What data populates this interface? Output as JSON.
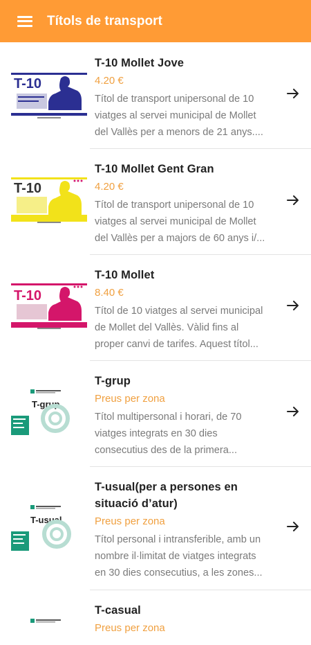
{
  "app": {
    "title": "Títols de transport"
  },
  "colors": {
    "accent": "#ff9b35",
    "price": "#f0a040"
  },
  "items": [
    {
      "title": "T-10 Mollet Jove",
      "price": "4.20 €",
      "desc1": "Títol de transport unipersonal de 10",
      "desc2": "viatges al servei municipal de Mollet",
      "desc3": "del Vallès per a menors de 21 anys....",
      "card_label": "T-10",
      "card_color": "#2b2f92"
    },
    {
      "title": "T-10 Mollet Gent Gran",
      "price": "4.20 €",
      "desc1": "Títol de transport unipersonal de 10",
      "desc2": "viatges al servei municipal de Mollet",
      "desc3": "del Vallès per a majors de 60 anys i/...",
      "card_label": "T-10",
      "card_color": "#f2e21a"
    },
    {
      "title": "T-10 Mollet",
      "price": "8.40 €",
      "desc1": "Títol de 10 viatges al servei municipal",
      "desc2": "de Mollet del Vallès. Vàlid fins al",
      "desc3": "proper canvi de tarifes. Aquest títol...",
      "card_label": "T-10",
      "card_color": "#d4166a"
    },
    {
      "title": "T-grup",
      "price": "Preus per zona",
      "desc1": "Títol multipersonal i horari, de 70",
      "desc2": "viatges integrats en 30 dies",
      "desc3": "consecutius des de la primera...",
      "card_label": "T-grup",
      "card_color": "#1a9a7a"
    },
    {
      "title": "T-usual(per a persones en",
      "title2": "situació d’atur)",
      "price": "Preus per zona",
      "desc1": "Títol personal i intransferible, amb un",
      "desc2": "nombre il·limitat de viatges integrats",
      "desc3": "en 30 dies consecutius, a les zones...",
      "card_label": "T-usual",
      "card_color": "#1a9a7a"
    },
    {
      "title": "T-casual",
      "price": "Preus per zona"
    }
  ]
}
